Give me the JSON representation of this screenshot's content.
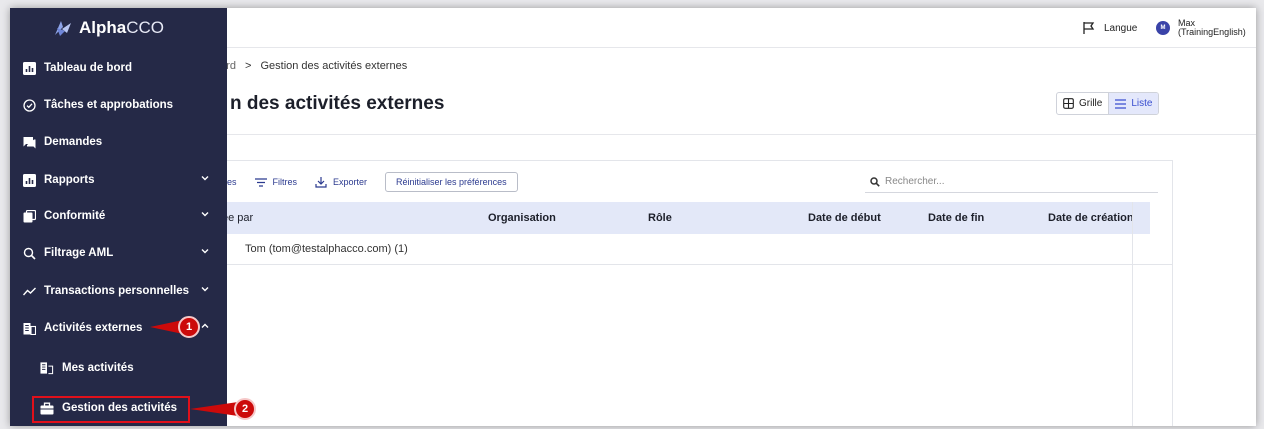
{
  "app": {
    "logo_bold": "Alpha",
    "logo_light": "CCO"
  },
  "header": {
    "language_label": "Langue",
    "user_initial": "M",
    "user_name": "Max",
    "user_role": "(TrainingEnglish)"
  },
  "sidebar": {
    "items": [
      {
        "label": "Tableau de bord"
      },
      {
        "label": "Tâches et approbations"
      },
      {
        "label": "Demandes"
      },
      {
        "label": "Rapports"
      },
      {
        "label": "Conformité"
      },
      {
        "label": "Filtrage AML"
      },
      {
        "label": "Transactions personnelles"
      },
      {
        "label": "Activités externes"
      },
      {
        "label": "Mes activités"
      },
      {
        "label": "Gestion des activités"
      }
    ]
  },
  "breadcrumb": {
    "first": "bord",
    "separator": ">",
    "current": "Gestion des activités externes"
  },
  "page": {
    "title": "n des activités externes"
  },
  "view_toggle": {
    "grid": "Grille",
    "list": "Liste"
  },
  "toolbar": {
    "columns": "nes",
    "filters": "Filtres",
    "export": "Exporter",
    "reset": "Réinitialiser les préférences"
  },
  "search": {
    "placeholder": "Rechercher..."
  },
  "table": {
    "headers": [
      "ée par",
      "Organisation",
      "Rôle",
      "Date de début",
      "Date de fin",
      "Date de création"
    ],
    "rows": [
      {
        "group": "Tom (tom@testalphacco.com) (1)"
      }
    ]
  },
  "callouts": [
    "1",
    "2"
  ],
  "colors": {
    "sidebar_bg": "#252947",
    "accent": "#3a4fd0",
    "callout_red": "#cc0a0a"
  }
}
